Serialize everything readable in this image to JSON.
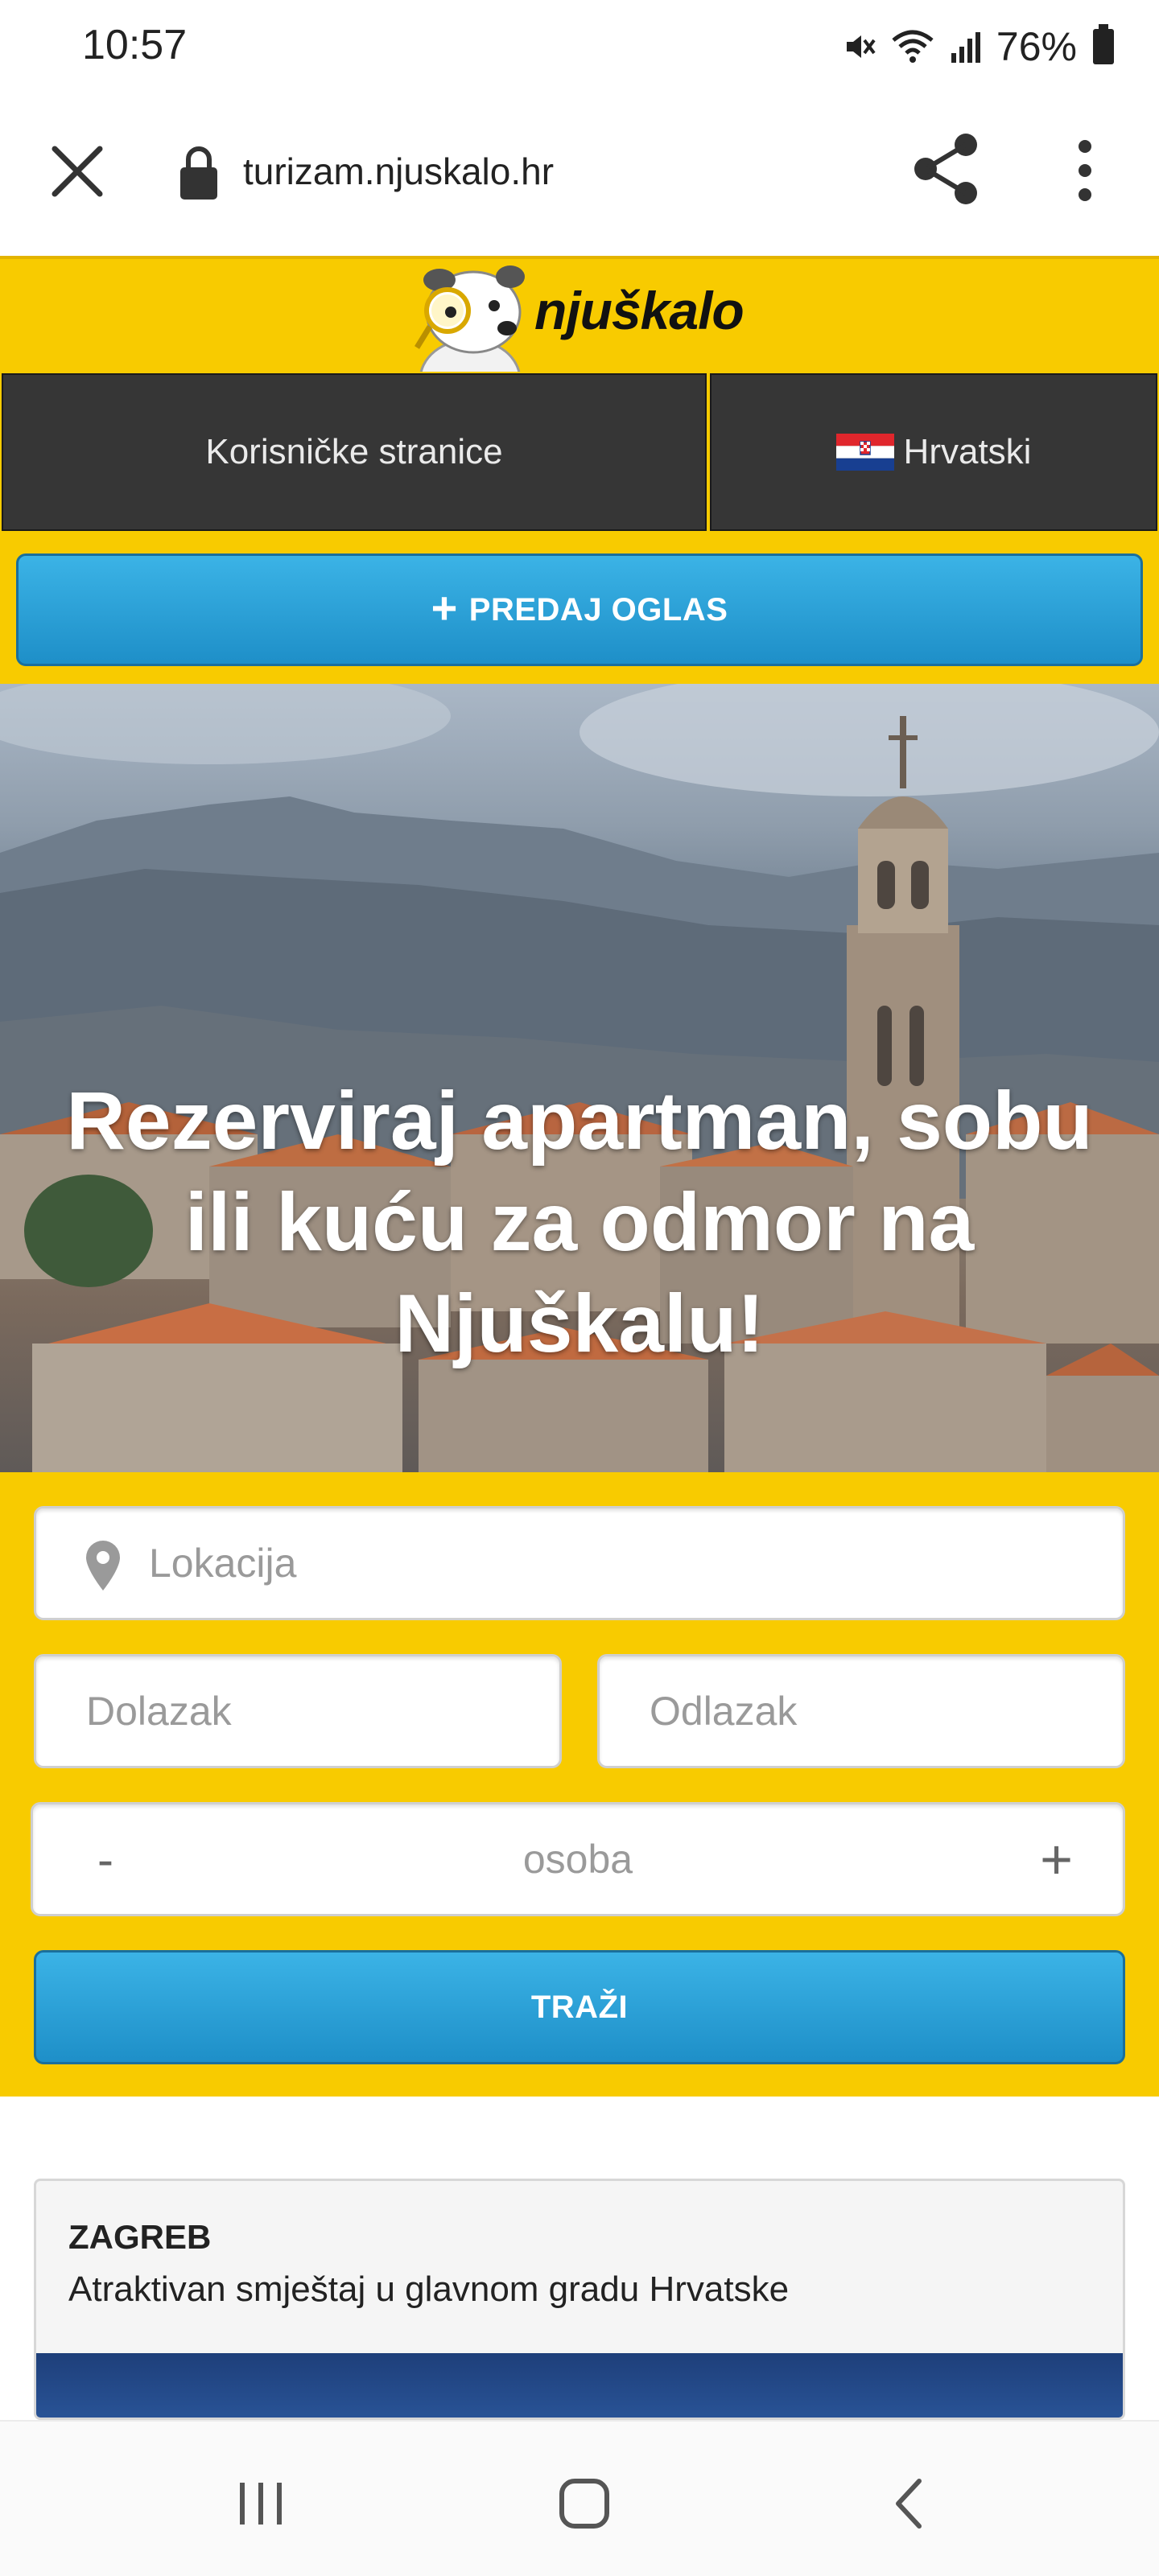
{
  "status_bar": {
    "time": "10:57",
    "battery": "76%",
    "icons": [
      "mute-icon",
      "wifi-icon",
      "signal-icon",
      "battery-icon"
    ]
  },
  "browser": {
    "url": "turizam.njuskalo.hr",
    "icons": [
      "close-icon",
      "lock-icon",
      "share-icon",
      "more-vert-icon"
    ]
  },
  "header": {
    "logo_text": "njuškalo"
  },
  "nav": {
    "user_pages": "Korisničke stranice",
    "language": "Hrvatski"
  },
  "actions": {
    "submit_ad": "PREDAJ OGLAS"
  },
  "hero": {
    "title": "Rezerviraj apartman, sobu ili kuću za odmor na Njuškalu!"
  },
  "search": {
    "location_placeholder": "Lokacija",
    "arrival_placeholder": "Dolazak",
    "departure_placeholder": "Odlazak",
    "persons_minus": "-",
    "persons_label": "osoba",
    "persons_plus": "+",
    "search_button": "TRAŽI"
  },
  "cards": [
    {
      "title": "ZAGREB",
      "subtitle": "Atraktivan smještaj u glavnom gradu Hrvatske"
    }
  ],
  "colors": {
    "brand_yellow": "#f8cb00",
    "button_blue": "#2a9fd8",
    "nav_dark": "#363636"
  }
}
